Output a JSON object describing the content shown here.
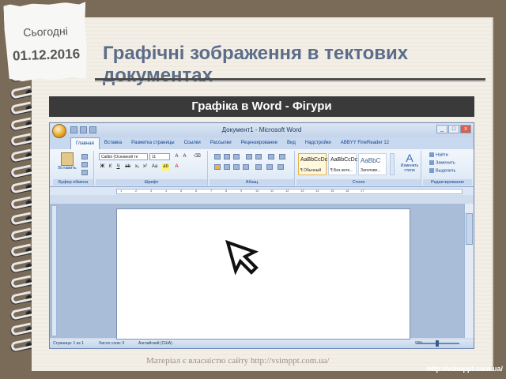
{
  "slide": {
    "today_label": "Сьогодні",
    "date": "01.12.2016",
    "title": "Графічні зображення в тектових документах",
    "banner": "Графіка в Word - Фігури",
    "footer_note": "Матеріал є власністю сайту http://vsimppt.com.ua/",
    "footer_url": "http://vsimppt.com.ua/"
  },
  "word": {
    "window_title": "Документ1 - Microsoft Word",
    "tabs": [
      "Главная",
      "Вставка",
      "Разметка страницы",
      "Ссылки",
      "Рассылки",
      "Рецензирование",
      "Вид",
      "Надстройки",
      "ABBYY FineReader 12"
    ],
    "active_tab": 0,
    "groups": {
      "clipboard": "Буфер обмена",
      "font": "Шрифт",
      "paragraph": "Абзац",
      "styles": "Стили",
      "editing": "Редактирование"
    },
    "paste_label": "Вставить",
    "font_name": "Calibri (Основной те",
    "font_size": "11",
    "styles": [
      {
        "sample": "AaBbCcDc",
        "name": "¶ Обычный"
      },
      {
        "sample": "AaBbCcDc",
        "name": "¶ Без инте..."
      },
      {
        "sample": "AaBbC",
        "name": "Заголово..."
      }
    ],
    "change_styles": "Изменить стили",
    "editing_items": [
      "Найти",
      "Заменить",
      "Выделить"
    ],
    "status": {
      "page": "Страница: 1 из 1",
      "words": "Число слов: 0",
      "language": "Английский (США)",
      "zoom": "90%"
    },
    "ruler_marks": [
      "1",
      "2",
      "3",
      "4",
      "5",
      "6",
      "7",
      "8",
      "9",
      "10",
      "11",
      "12",
      "13",
      "14",
      "15",
      "16",
      "17"
    ]
  },
  "colors": {
    "title": "#5b6d8a",
    "banner_bg": "#3a3a3a",
    "ribbon": "#dbe7f5"
  }
}
